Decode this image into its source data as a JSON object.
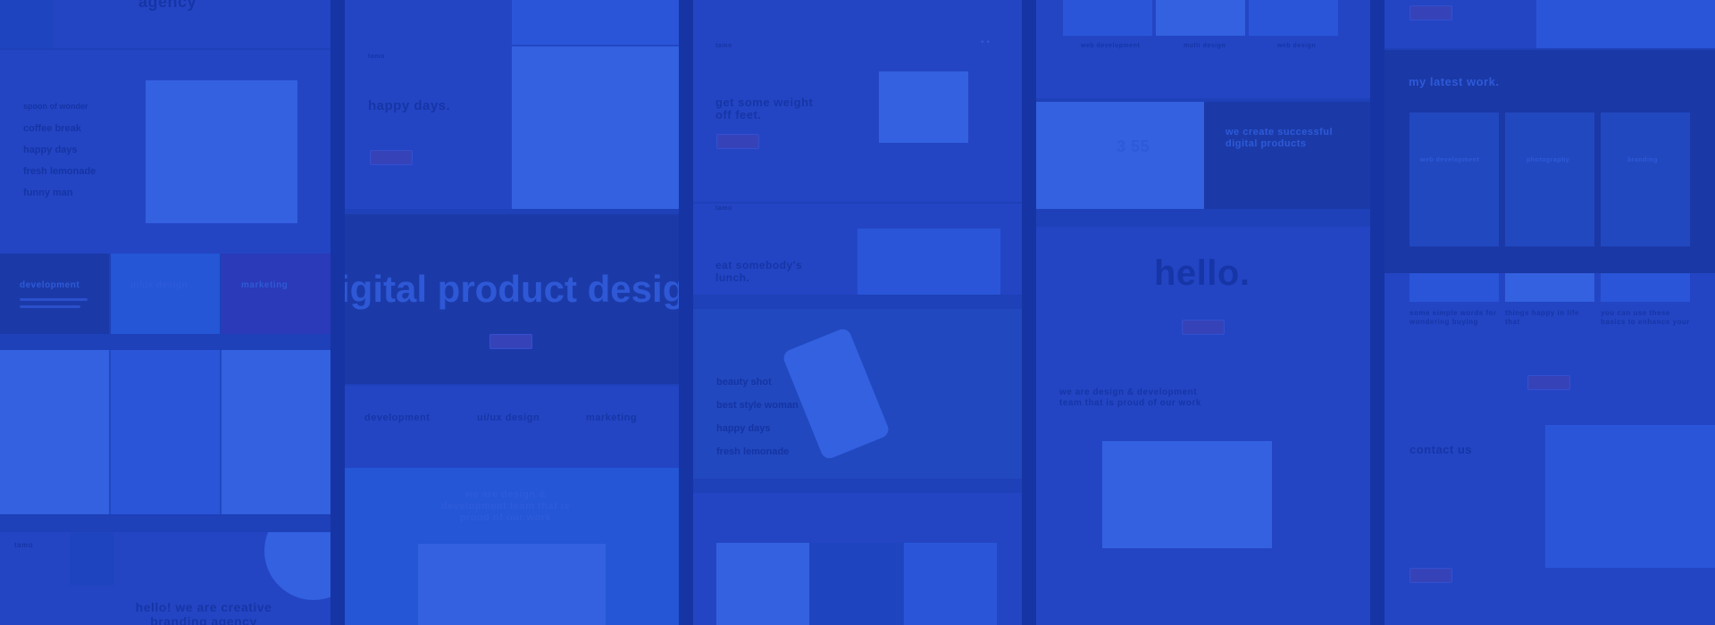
{
  "col1": {
    "agency_fragment": "agency",
    "menu": [
      "spoon of wonder",
      "coffee break",
      "happy days",
      "fresh lemonade",
      "funny man"
    ],
    "services": [
      {
        "label": "development"
      },
      {
        "label": "ui/ux design"
      },
      {
        "label": "marketing"
      }
    ],
    "hello_text": "hello! we are creative branding agency",
    "logo": "tamo"
  },
  "col2": {
    "logo": "tamo",
    "happy_days": "happy days.",
    "big_heading": "igital product desig",
    "services": [
      "development",
      "ui/ux design",
      "marketing"
    ],
    "tagline": "we are design & development team that is proud of our work"
  },
  "col3": {
    "logo": "tamo",
    "weight_heading": "get some weight off feet.",
    "lunch_heading": "eat somebody's lunch.",
    "phone_menu": [
      "beauty shot",
      "best style woman",
      "happy days",
      "fresh lemonade"
    ],
    "clock": "3 55"
  },
  "col4": {
    "captions": [
      "web development",
      "multi design",
      "web design"
    ],
    "create_heading": "we create successful digital products",
    "hello": "hello.",
    "tagline": "we are design & development team that is proud of our work"
  },
  "col5": {
    "latest_work": "my latest work.",
    "work_titles": [
      "web development",
      "photography",
      "branding"
    ],
    "blog_titles": [
      "some simple words for wondering buying",
      "things happy in life that",
      "you can use these basics to enhance your"
    ],
    "contact": "contact us"
  },
  "colors": {
    "overlay": "#1a3bb0",
    "panel_light": "#2345c4",
    "panel_dark": "#1b3aa8",
    "accent_pink": "#3643b8"
  }
}
